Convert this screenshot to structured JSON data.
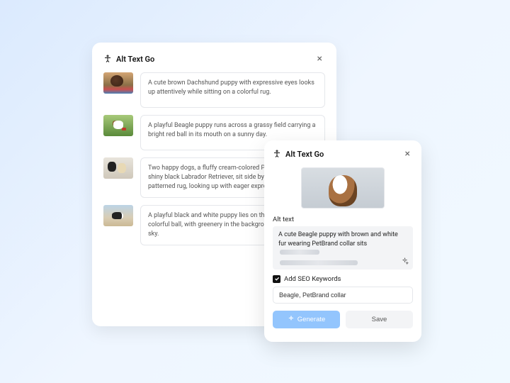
{
  "app_title": "Alt Text Go",
  "list": [
    {
      "alt": "A cute brown Dachshund puppy with expressive eyes looks up attentively while sitting on a colorful rug."
    },
    {
      "alt": "A playful Beagle puppy runs across a grassy field carrying a bright red ball in its mouth on a sunny day."
    },
    {
      "alt": "Two happy dogs, a fluffy cream-colored Pomeranian and a shiny black Labrador Retriever, sit side by side on a patterned rug, looking up with eager expressions."
    },
    {
      "alt": "A playful black and white puppy lies on the sand next to a colorful ball, with greenery in the background under a clear sky."
    }
  ],
  "detail": {
    "alt_label": "Alt text",
    "alt_value": "A cute Beagle puppy with brown and white fur wearing PetBrand collar sits",
    "seo_checked": true,
    "seo_label": "Add SEO Keywords",
    "seo_value": "Beagle, PetBrand collar",
    "generate_label": "Generate",
    "save_label": "Save"
  }
}
